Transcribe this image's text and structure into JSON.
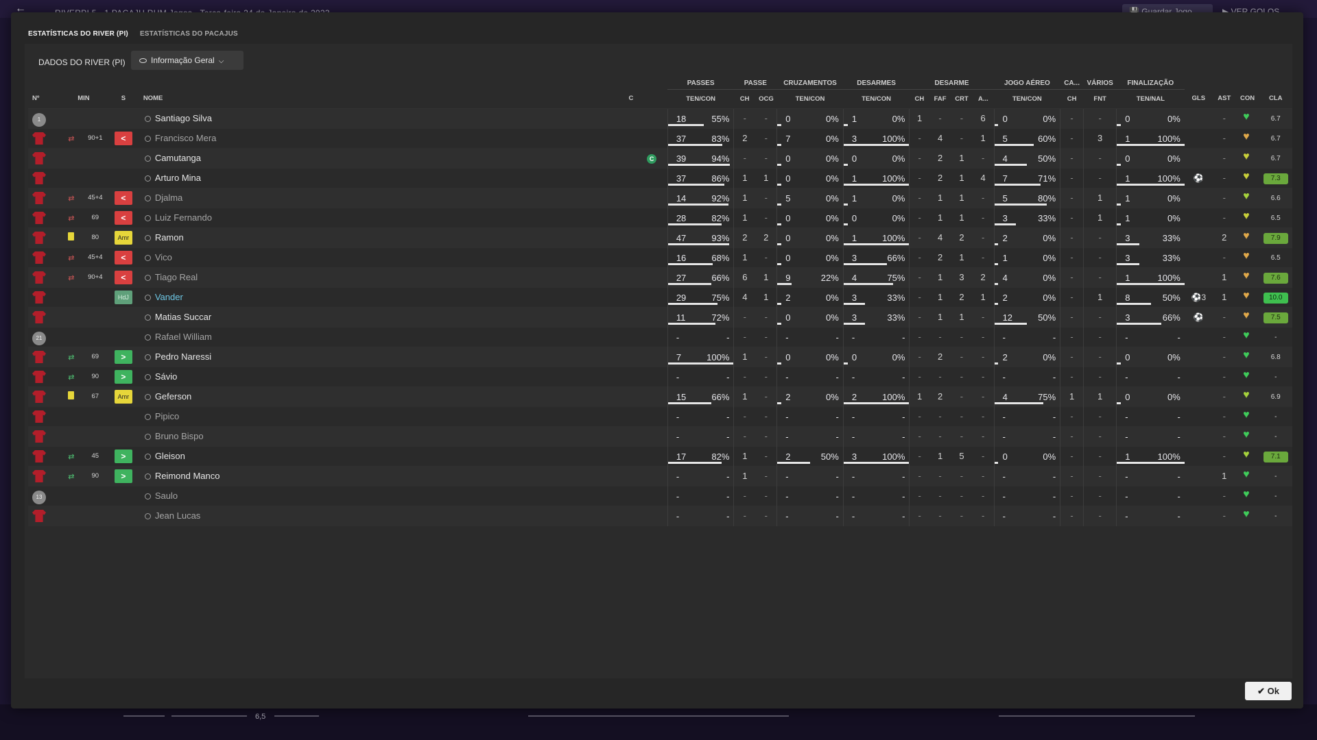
{
  "topbar": {
    "match": "RIVERPI 5 - 1 PACAJU  RHM Jogos  -  Terça-feira 24 de Janeiro de 2023",
    "save": "Guardar Jogo",
    "goals": "VER GOLOS"
  },
  "tabs": [
    "ESTATÍSTICAS DO RIVER (PI)",
    "ESTATÍSTICAS DO PACAJUS"
  ],
  "sub_header": {
    "title": "DADOS DO RIVER (PI)",
    "view": "Informação Geral"
  },
  "groups": [
    {
      "label": "PASSES",
      "span": 2
    },
    {
      "label": "PASSE",
      "span": 2
    },
    {
      "label": "CRUZAMENTOS",
      "span": 2
    },
    {
      "label": "DESARMES",
      "span": 2
    },
    {
      "label": "DESARME",
      "span": 4
    },
    {
      "label": "JOGO AÉREO",
      "span": 2
    },
    {
      "label": "CA...",
      "span": 1
    },
    {
      "label": "VÁRIOS",
      "span": 1
    },
    {
      "label": "FINALIZAÇÃO",
      "span": 2
    }
  ],
  "columns": {
    "no": "Nº",
    "min": "MIN",
    "s": "S",
    "name": "NOME",
    "c": "C",
    "stat": [
      "TEN/CON",
      "CH",
      "OCG",
      "TEN/CON",
      "TEN/CON",
      "CH",
      "FAF",
      "CRT",
      "A...",
      "TEN/CON",
      "CH",
      "FNT",
      "TEN/NAL"
    ],
    "tail": [
      "GLS",
      "AST",
      "CON",
      "CLA"
    ]
  },
  "players": [
    {
      "no": "1",
      "kit": "gray",
      "sub": "",
      "mins": "",
      "ev": "",
      "evt": "",
      "name": "Santiago Silva",
      "nm": "",
      "cap": "",
      "pt": "18",
      "pp": "55%",
      "pch": "-",
      "pocg": "-",
      "ct": "0",
      "cp": "0%",
      "dt": "1",
      "dp": "0%",
      "d1": "1",
      "d2": "-",
      "d3": "-",
      "d4": "6",
      "at": "0",
      "ap": "0%",
      "cach": "-",
      "fnt": "-",
      "ft": "0",
      "fp": "0%",
      "gls": "",
      "ast": "-",
      "con": "g",
      "cla": "6.7",
      "clc": ""
    },
    {
      "no": "",
      "kit": "red",
      "sub": "out",
      "mins": "90+1",
      "ev": "out",
      "evt": "<",
      "name": "Francisco Mera",
      "nm": "dim",
      "cap": "",
      "pt": "37",
      "pp": "83%",
      "pch": "2",
      "pocg": "-",
      "ct": "7",
      "cp": "0%",
      "dt": "3",
      "dp": "100%",
      "d1": "-",
      "d2": "4",
      "d3": "-",
      "d4": "1",
      "at": "5",
      "ap": "60%",
      "cach": "-",
      "fnt": "3",
      "ft": "1",
      "fp": "100%",
      "gls": "",
      "ast": "-",
      "con": "o",
      "cla": "6.7",
      "clc": ""
    },
    {
      "no": "",
      "kit": "red",
      "sub": "",
      "mins": "",
      "ev": "",
      "evt": "",
      "name": "Camutanga",
      "nm": "",
      "cap": "C",
      "pt": "39",
      "pp": "94%",
      "pch": "-",
      "pocg": "-",
      "ct": "0",
      "cp": "0%",
      "dt": "0",
      "dp": "0%",
      "d1": "-",
      "d2": "2",
      "d3": "1",
      "d4": "-",
      "at": "4",
      "ap": "50%",
      "cach": "-",
      "fnt": "-",
      "ft": "0",
      "fp": "0%",
      "gls": "",
      "ast": "-",
      "con": "y",
      "cla": "6.7",
      "clc": ""
    },
    {
      "no": "",
      "kit": "red",
      "sub": "",
      "mins": "",
      "ev": "",
      "evt": "",
      "name": "Arturo Mina",
      "nm": "",
      "cap": "",
      "pt": "37",
      "pp": "86%",
      "pch": "1",
      "pocg": "1",
      "ct": "0",
      "cp": "0%",
      "dt": "1",
      "dp": "100%",
      "d1": "-",
      "d2": "2",
      "d3": "1",
      "d4": "4",
      "at": "7",
      "ap": "71%",
      "cach": "-",
      "fnt": "-",
      "ft": "1",
      "fp": "100%",
      "gls": "⚽",
      "ast": "-",
      "con": "y",
      "cla": "7.3",
      "clc": "g"
    },
    {
      "no": "",
      "kit": "red",
      "sub": "out",
      "mins": "45+4",
      "ev": "out",
      "evt": "<",
      "name": "Djalma",
      "nm": "dim",
      "cap": "",
      "pt": "14",
      "pp": "92%",
      "pch": "1",
      "pocg": "-",
      "ct": "5",
      "cp": "0%",
      "dt": "1",
      "dp": "0%",
      "d1": "-",
      "d2": "1",
      "d3": "1",
      "d4": "-",
      "at": "5",
      "ap": "80%",
      "cach": "-",
      "fnt": "1",
      "ft": "1",
      "fp": "0%",
      "gls": "",
      "ast": "-",
      "con": "yg",
      "cla": "6.6",
      "clc": ""
    },
    {
      "no": "",
      "kit": "red",
      "sub": "out",
      "mins": "69",
      "ev": "out",
      "evt": "<",
      "name": "Luiz Fernando",
      "nm": "dim",
      "cap": "",
      "pt": "28",
      "pp": "82%",
      "pch": "1",
      "pocg": "-",
      "ct": "0",
      "cp": "0%",
      "dt": "0",
      "dp": "0%",
      "d1": "-",
      "d2": "1",
      "d3": "1",
      "d4": "-",
      "at": "3",
      "ap": "33%",
      "cach": "-",
      "fnt": "1",
      "ft": "1",
      "fp": "0%",
      "gls": "",
      "ast": "-",
      "con": "y",
      "cla": "6.5",
      "clc": ""
    },
    {
      "no": "",
      "kit": "red",
      "sub": "card",
      "mins": "80",
      "ev": "amr",
      "evt": "Amr",
      "name": "Ramon",
      "nm": "",
      "cap": "",
      "pt": "47",
      "pp": "93%",
      "pch": "2",
      "pocg": "2",
      "ct": "0",
      "cp": "0%",
      "dt": "1",
      "dp": "100%",
      "d1": "-",
      "d2": "4",
      "d3": "2",
      "d4": "-",
      "at": "2",
      "ap": "0%",
      "cach": "-",
      "fnt": "-",
      "ft": "3",
      "fp": "33%",
      "gls": "",
      "ast": "2",
      "con": "o",
      "cla": "7.9",
      "clc": "g"
    },
    {
      "no": "",
      "kit": "red",
      "sub": "out",
      "mins": "45+4",
      "ev": "out",
      "evt": "<",
      "name": "Vico",
      "nm": "dim",
      "cap": "",
      "pt": "16",
      "pp": "68%",
      "pch": "1",
      "pocg": "-",
      "ct": "0",
      "cp": "0%",
      "dt": "3",
      "dp": "66%",
      "d1": "-",
      "d2": "2",
      "d3": "1",
      "d4": "-",
      "at": "1",
      "ap": "0%",
      "cach": "-",
      "fnt": "-",
      "ft": "3",
      "fp": "33%",
      "gls": "",
      "ast": "-",
      "con": "o",
      "cla": "6.5",
      "clc": ""
    },
    {
      "no": "",
      "kit": "red",
      "sub": "out",
      "mins": "90+4",
      "ev": "out",
      "evt": "<",
      "name": "Tiago Real",
      "nm": "dim",
      "cap": "",
      "pt": "27",
      "pp": "66%",
      "pch": "6",
      "pocg": "1",
      "ct": "9",
      "cp": "22%",
      "dt": "4",
      "dp": "75%",
      "d1": "-",
      "d2": "1",
      "d3": "3",
      "d4": "2",
      "at": "4",
      "ap": "0%",
      "cach": "-",
      "fnt": "-",
      "ft": "1",
      "fp": "100%",
      "gls": "",
      "ast": "1",
      "con": "o",
      "cla": "7.6",
      "clc": "g"
    },
    {
      "no": "",
      "kit": "red",
      "sub": "",
      "mins": "",
      "ev": "hdj",
      "evt": "HdJ",
      "name": "Vander",
      "nm": "hl",
      "cap": "",
      "pt": "29",
      "pp": "75%",
      "pch": "4",
      "pocg": "1",
      "ct": "2",
      "cp": "0%",
      "dt": "3",
      "dp": "33%",
      "d1": "-",
      "d2": "1",
      "d3": "2",
      "d4": "1",
      "at": "2",
      "ap": "0%",
      "cach": "-",
      "fnt": "1",
      "ft": "8",
      "fp": "50%",
      "gls": "⚽3",
      "ast": "1",
      "con": "o",
      "cla": "10.0",
      "clc": "bg"
    },
    {
      "no": "",
      "kit": "red",
      "sub": "",
      "mins": "",
      "ev": "",
      "evt": "",
      "name": "Matias Succar",
      "nm": "",
      "cap": "",
      "pt": "11",
      "pp": "72%",
      "pch": "-",
      "pocg": "-",
      "ct": "0",
      "cp": "0%",
      "dt": "3",
      "dp": "33%",
      "d1": "-",
      "d2": "1",
      "d3": "1",
      "d4": "-",
      "at": "12",
      "ap": "50%",
      "cach": "-",
      "fnt": "-",
      "ft": "3",
      "fp": "66%",
      "gls": "⚽",
      "ast": "-",
      "con": "o",
      "cla": "7.5",
      "clc": "g"
    },
    {
      "no": "21",
      "kit": "gray",
      "sub": "",
      "mins": "",
      "ev": "",
      "evt": "",
      "name": "Rafael William",
      "nm": "dim",
      "cap": "",
      "pt": "-",
      "pp": "-",
      "pch": "-",
      "pocg": "-",
      "ct": "-",
      "cp": "-",
      "dt": "-",
      "dp": "-",
      "d1": "-",
      "d2": "-",
      "d3": "-",
      "d4": "-",
      "at": "-",
      "ap": "-",
      "cach": "-",
      "fnt": "-",
      "ft": "-",
      "fp": "-",
      "gls": "",
      "ast": "-",
      "con": "g",
      "cla": "-",
      "clc": ""
    },
    {
      "no": "",
      "kit": "red",
      "sub": "in",
      "mins": "69",
      "ev": "in",
      "evt": ">",
      "name": "Pedro Naressi",
      "nm": "",
      "cap": "",
      "pt": "7",
      "pp": "100%",
      "pch": "1",
      "pocg": "-",
      "ct": "0",
      "cp": "0%",
      "dt": "0",
      "dp": "0%",
      "d1": "-",
      "d2": "2",
      "d3": "-",
      "d4": "-",
      "at": "2",
      "ap": "0%",
      "cach": "-",
      "fnt": "-",
      "ft": "0",
      "fp": "0%",
      "gls": "",
      "ast": "-",
      "con": "g",
      "cla": "6.8",
      "clc": ""
    },
    {
      "no": "",
      "kit": "red",
      "sub": "in",
      "mins": "90",
      "ev": "in",
      "evt": ">",
      "name": "Sávio",
      "nm": "",
      "cap": "",
      "pt": "-",
      "pp": "-",
      "pch": "-",
      "pocg": "-",
      "ct": "-",
      "cp": "-",
      "dt": "-",
      "dp": "-",
      "d1": "-",
      "d2": "-",
      "d3": "-",
      "d4": "-",
      "at": "-",
      "ap": "-",
      "cach": "-",
      "fnt": "-",
      "ft": "-",
      "fp": "-",
      "gls": "",
      "ast": "-",
      "con": "g",
      "cla": "-",
      "clc": ""
    },
    {
      "no": "",
      "kit": "red",
      "sub": "card",
      "mins": "67",
      "ev": "amr",
      "evt": "Amr",
      "name": "Geferson",
      "nm": "",
      "cap": "",
      "pt": "15",
      "pp": "66%",
      "pch": "1",
      "pocg": "-",
      "ct": "2",
      "cp": "0%",
      "dt": "2",
      "dp": "100%",
      "d1": "1",
      "d2": "2",
      "d3": "-",
      "d4": "-",
      "at": "4",
      "ap": "75%",
      "cach": "1",
      "fnt": "1",
      "ft": "0",
      "fp": "0%",
      "gls": "",
      "ast": "-",
      "con": "yg",
      "cla": "6.9",
      "clc": ""
    },
    {
      "no": "",
      "kit": "red",
      "sub": "",
      "mins": "",
      "ev": "",
      "evt": "",
      "name": "Pipico",
      "nm": "dim",
      "cap": "",
      "pt": "-",
      "pp": "-",
      "pch": "-",
      "pocg": "-",
      "ct": "-",
      "cp": "-",
      "dt": "-",
      "dp": "-",
      "d1": "-",
      "d2": "-",
      "d3": "-",
      "d4": "-",
      "at": "-",
      "ap": "-",
      "cach": "-",
      "fnt": "-",
      "ft": "-",
      "fp": "-",
      "gls": "",
      "ast": "-",
      "con": "g",
      "cla": "-",
      "clc": ""
    },
    {
      "no": "",
      "kit": "red",
      "sub": "",
      "mins": "",
      "ev": "",
      "evt": "",
      "name": "Bruno Bispo",
      "nm": "dim",
      "cap": "",
      "pt": "-",
      "pp": "-",
      "pch": "-",
      "pocg": "-",
      "ct": "-",
      "cp": "-",
      "dt": "-",
      "dp": "-",
      "d1": "-",
      "d2": "-",
      "d3": "-",
      "d4": "-",
      "at": "-",
      "ap": "-",
      "cach": "-",
      "fnt": "-",
      "ft": "-",
      "fp": "-",
      "gls": "",
      "ast": "-",
      "con": "g",
      "cla": "-",
      "clc": ""
    },
    {
      "no": "",
      "kit": "red",
      "sub": "in",
      "mins": "45",
      "ev": "in",
      "evt": ">",
      "name": "Gleison",
      "nm": "",
      "cap": "",
      "pt": "17",
      "pp": "82%",
      "pch": "1",
      "pocg": "-",
      "ct": "2",
      "cp": "50%",
      "dt": "3",
      "dp": "100%",
      "d1": "-",
      "d2": "1",
      "d3": "5",
      "d4": "-",
      "at": "0",
      "ap": "0%",
      "cach": "-",
      "fnt": "-",
      "ft": "1",
      "fp": "100%",
      "gls": "",
      "ast": "-",
      "con": "yg",
      "cla": "7.1",
      "clc": "g"
    },
    {
      "no": "",
      "kit": "red",
      "sub": "in",
      "mins": "90",
      "ev": "in",
      "evt": ">",
      "name": "Reimond Manco",
      "nm": "",
      "cap": "",
      "pt": "-",
      "pp": "-",
      "pch": "1",
      "pocg": "-",
      "ct": "-",
      "cp": "-",
      "dt": "-",
      "dp": "-",
      "d1": "-",
      "d2": "-",
      "d3": "-",
      "d4": "-",
      "at": "-",
      "ap": "-",
      "cach": "-",
      "fnt": "-",
      "ft": "-",
      "fp": "-",
      "gls": "",
      "ast": "1",
      "con": "g",
      "cla": "-",
      "clc": ""
    },
    {
      "no": "13",
      "kit": "gray",
      "sub": "",
      "mins": "",
      "ev": "",
      "evt": "",
      "name": "Saulo",
      "nm": "dim",
      "cap": "",
      "pt": "-",
      "pp": "-",
      "pch": "-",
      "pocg": "-",
      "ct": "-",
      "cp": "-",
      "dt": "-",
      "dp": "-",
      "d1": "-",
      "d2": "-",
      "d3": "-",
      "d4": "-",
      "at": "-",
      "ap": "-",
      "cach": "-",
      "fnt": "-",
      "ft": "-",
      "fp": "-",
      "gls": "",
      "ast": "-",
      "con": "g",
      "cla": "-",
      "clc": ""
    },
    {
      "no": "",
      "kit": "red",
      "sub": "",
      "mins": "",
      "ev": "",
      "evt": "",
      "name": "Jean Lucas",
      "nm": "dim",
      "cap": "",
      "pt": "-",
      "pp": "-",
      "pch": "-",
      "pocg": "-",
      "ct": "-",
      "cp": "-",
      "dt": "-",
      "dp": "-",
      "d1": "-",
      "d2": "-",
      "d3": "-",
      "d4": "-",
      "at": "-",
      "ap": "-",
      "cach": "-",
      "fnt": "-",
      "ft": "-",
      "fp": "-",
      "gls": "",
      "ast": "-",
      "con": "g",
      "cla": "-",
      "clc": ""
    }
  ],
  "bottom": {
    "value": "6,5"
  },
  "ok": "Ok"
}
